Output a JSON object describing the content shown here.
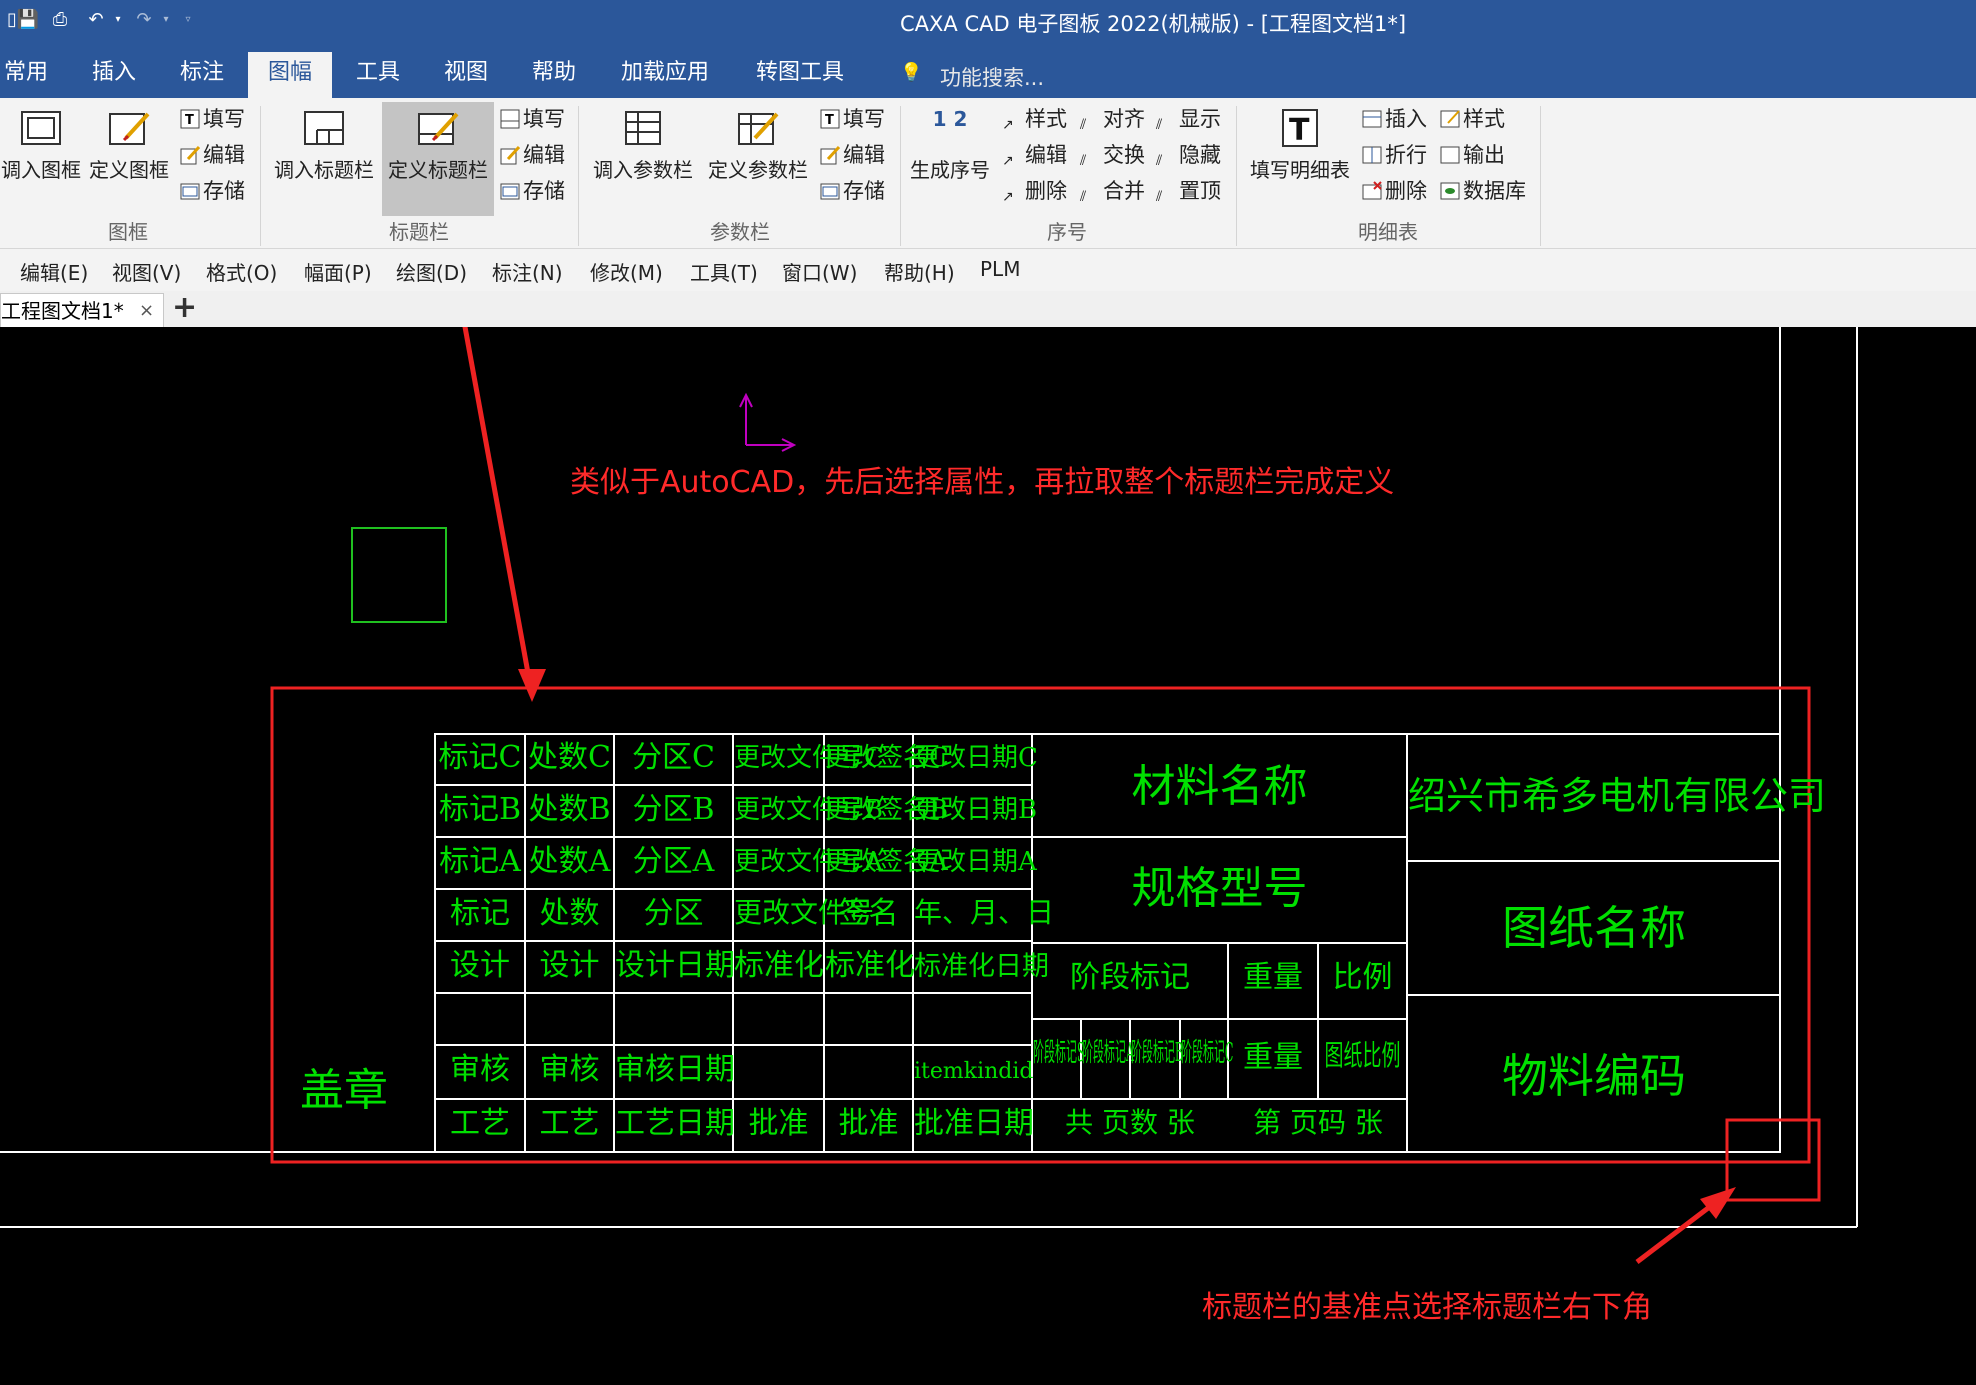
{
  "window": {
    "title": "CAXA CAD 电子图板 2022(机械版) - [工程图文档1*]"
  },
  "tabs": [
    "常用",
    "插入",
    "标注",
    "图幅",
    "工具",
    "视图",
    "帮助",
    "加载应用",
    "转图工具"
  ],
  "active_tab": "图幅",
  "search": {
    "placeholder": "功能搜索..."
  },
  "ribbon": {
    "frame": {
      "label": "图框",
      "load": "调入图框",
      "define": "定义图框",
      "fill": "填写",
      "edit": "编辑",
      "save": "存储"
    },
    "titlebar": {
      "label": "标题栏",
      "load": "调入标题栏",
      "define": "定义标题栏",
      "fill": "填写",
      "edit": "编辑",
      "save": "存储"
    },
    "param": {
      "label": "参数栏",
      "load": "调入参数栏",
      "define": "定义参数栏",
      "fill": "填写",
      "edit": "编辑",
      "save": "存储"
    },
    "seq": {
      "label": "序号",
      "generate": "生成序号",
      "numbers": "1 2",
      "style": "样式",
      "align": "对齐",
      "show": "显示",
      "edit": "编辑",
      "swap": "交换",
      "hide": "隐藏",
      "delete": "删除",
      "merge": "合并",
      "top": "置顶"
    },
    "bom": {
      "label": "明细表",
      "fill": "填写明细表",
      "insert": "插入",
      "style": "样式",
      "fold": "折行",
      "output": "输出",
      "delete": "删除",
      "database": "数据库"
    }
  },
  "menubar": [
    "编辑(E)",
    "视图(V)",
    "格式(O)",
    "幅面(P)",
    "绘图(D)",
    "标注(N)",
    "修改(M)",
    "工具(T)",
    "窗口(W)",
    "帮助(H)",
    "PLM"
  ],
  "doc_tab": {
    "label": "工程图文档1*",
    "close": "×",
    "add": "+"
  },
  "drawing": {
    "seal": "盖章",
    "rev_rows": [
      [
        "标记C",
        "处数C",
        "分区C",
        "更改文件号C",
        "更改签名C",
        "更改日期C"
      ],
      [
        "标记B",
        "处数B",
        "分区B",
        "更改文件号B",
        "更改签名B",
        "更改日期B"
      ],
      [
        "标记A",
        "处数A",
        "分区A",
        "更改文件号A",
        "更改签名A",
        "更改日期A"
      ],
      [
        "标记",
        "处数",
        "分区",
        "更改文件号",
        "签名",
        "年、月、日"
      ]
    ],
    "sign_rows": [
      [
        "设计",
        "设计",
        "设计日期",
        "标准化",
        "标准化",
        "标准化日期"
      ],
      [
        "",
        "",
        "",
        "",
        "",
        ""
      ],
      [
        "审核",
        "审核",
        "审核日期",
        "",
        "",
        "itemkindid"
      ],
      [
        "工艺",
        "工艺",
        "工艺日期",
        "批准",
        "批准",
        "批准日期"
      ]
    ],
    "material": "材料名称",
    "spec": "规格型号",
    "stage": "阶段标记",
    "weight": "重量",
    "scale": "比例",
    "stage_cells": [
      "阶段标记S",
      "阶段标记A",
      "阶段标记B",
      "阶段标记C"
    ],
    "weight_value": "重量",
    "scale_value": "图纸比例",
    "total_sheets": "共 页数 张",
    "sheet_no": "第 页码 张",
    "company": "绍兴市希多电机有限公司",
    "drawing_name": "图纸名称",
    "material_code": "物料编码"
  },
  "annotations": {
    "top": "类似于AutoCAD，先后选择属性，再拉取整个标题栏完成定义",
    "bottom": "标题栏的基准点选择标题栏右下角"
  },
  "colors": {
    "ribbon_blue": "#2b579a",
    "cad_green": "#00e000",
    "annotation_red": "#ff2a2a",
    "ucs_magenta": "#c000c0"
  }
}
